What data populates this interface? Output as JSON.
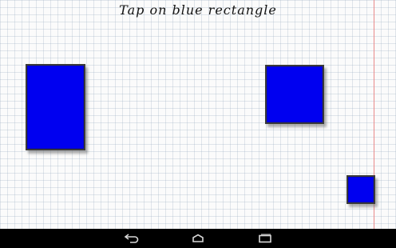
{
  "game": {
    "instruction": "Tap on blue rectangle",
    "rectangle_color": "#0000f0",
    "margin_line_color": "#e98a8a"
  },
  "navigation": {
    "back_icon": "back-arrow-icon",
    "home_icon": "home-icon",
    "recent_icon": "recent-apps-icon"
  }
}
